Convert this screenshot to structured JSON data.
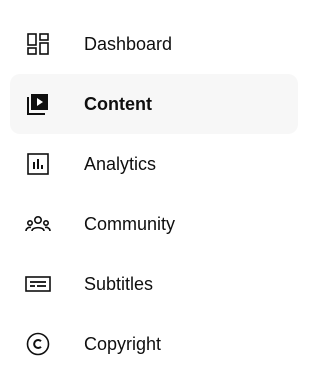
{
  "sidebar": {
    "active_index": 1,
    "items": [
      {
        "label": "Dashboard",
        "icon": "dashboard-icon"
      },
      {
        "label": "Content",
        "icon": "content-icon"
      },
      {
        "label": "Analytics",
        "icon": "analytics-icon"
      },
      {
        "label": "Community",
        "icon": "community-icon"
      },
      {
        "label": "Subtitles",
        "icon": "subtitles-icon"
      },
      {
        "label": "Copyright",
        "icon": "copyright-icon"
      }
    ]
  },
  "colors": {
    "text": "#0f0f0f",
    "active_background": "#f7f7f7",
    "background": "#ffffff"
  }
}
